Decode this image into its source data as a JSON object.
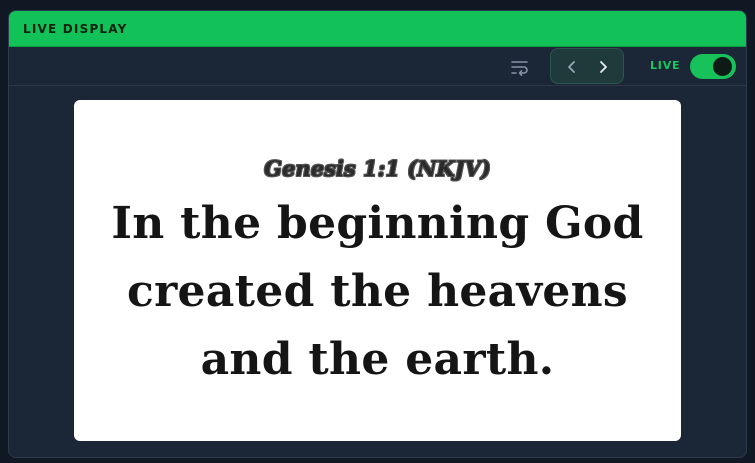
{
  "panel": {
    "title": "LIVE DISPLAY"
  },
  "toolbar": {
    "wrap_icon": "text-wrap-icon",
    "prev_icon": "chevron-left-icon",
    "next_icon": "chevron-right-icon",
    "live_label": "LIVE",
    "live_enabled": true
  },
  "slide": {
    "reference": "Genesis 1:1 (NKJV)",
    "verse_lines": [
      "In the beginning God",
      "created the heavens",
      "and the earth."
    ]
  },
  "colors": {
    "accent": "#12c157",
    "panel_bg": "#1b2636",
    "page_bg": "#101823",
    "slide_bg": "#ffffff"
  }
}
